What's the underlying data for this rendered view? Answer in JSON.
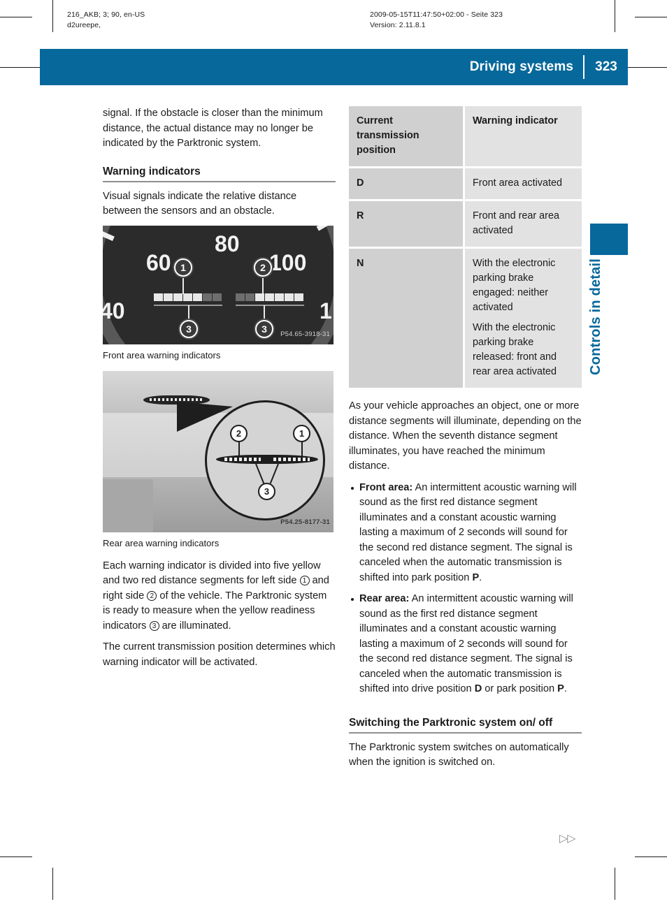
{
  "imprint": {
    "left_line1": "216_AKB; 3; 90, en-US",
    "left_line2": "d2ureepe,",
    "right_line1": "2009-05-15T11:47:50+02:00 - Seite 323",
    "right_line2": "Version: 2.11.8.1"
  },
  "header": {
    "title": "Driving systems",
    "page_number": "323",
    "accent_color": "#06689b"
  },
  "thumb_tab": {
    "label": "Controls in detail",
    "color": "#06689b"
  },
  "left_column": {
    "intro_paragraph": "signal. If the obstacle is closer than the minimum distance, the actual distance may no longer be indicated by the Parktronic system.",
    "heading": "Warning indicators",
    "lead_paragraph": "Visual signals indicate the relative distance between the sensors and an obstacle.",
    "figure1": {
      "caption": "Front area warning indicators",
      "code": "P54.65-3918-31",
      "dial_numbers": [
        "40",
        "60",
        "80",
        "100",
        "1"
      ],
      "callouts": [
        "1",
        "2",
        "3",
        "3"
      ]
    },
    "figure2": {
      "caption": "Rear area warning indicators",
      "code": "P54.25-8177-31",
      "callouts": [
        "2",
        "1",
        "3"
      ]
    },
    "body_paragraph_1_a": "Each warning indicator is divided into five yellow and two red distance segments for left side ",
    "body_ref_1": "1",
    "body_paragraph_1_b": " and right side ",
    "body_ref_2": "2",
    "body_paragraph_1_c": " of the vehicle. The Parktronic system is ready to measure when the yellow readiness indicators ",
    "body_ref_3": "3",
    "body_paragraph_1_d": " are illuminated.",
    "body_paragraph_2": "The current transmission position determines which warning indicator will be activated."
  },
  "right_column": {
    "table": {
      "headers": [
        "Current transmission position",
        "Warning indicator"
      ],
      "rows": [
        {
          "position": "D",
          "indicator": [
            "Front area activated"
          ]
        },
        {
          "position": "R",
          "indicator": [
            "Front and rear area activated"
          ]
        },
        {
          "position": "N",
          "indicator": [
            "With the electronic parking brake engaged: neither activated",
            "With the electronic parking brake released: front and rear area activated"
          ]
        }
      ]
    },
    "paragraph_after_table": "As your vehicle approaches an object, one or more distance segments will illuminate, depending on the distance. When the seventh distance segment illuminates, you have reached the minimum distance.",
    "bullets": [
      {
        "lead": "Front area:",
        "text_a": " An intermittent acoustic warning will sound as the first red distance segment illuminates and a constant acoustic warning lasting a maximum of 2 seconds will sound for the second red distance segment. The signal is canceled when the automatic transmission is shifted into park position ",
        "bold_1": "P",
        "text_b": "."
      },
      {
        "lead": "Rear area:",
        "text_a": " An intermittent acoustic warning will sound as the first red distance segment illuminates and a constant acoustic warning lasting a maximum of 2 seconds will sound for the second red distance segment. The signal is canceled when the automatic transmission is shifted into drive position ",
        "bold_1": "D",
        "text_b": " or park position ",
        "bold_2": "P",
        "text_c": "."
      }
    ],
    "heading": "Switching the Parktronic system on/ off",
    "closing_paragraph": "The Parktronic system switches on automatically when the ignition is switched on."
  },
  "footer": {
    "continuation_marker": "▷▷"
  }
}
